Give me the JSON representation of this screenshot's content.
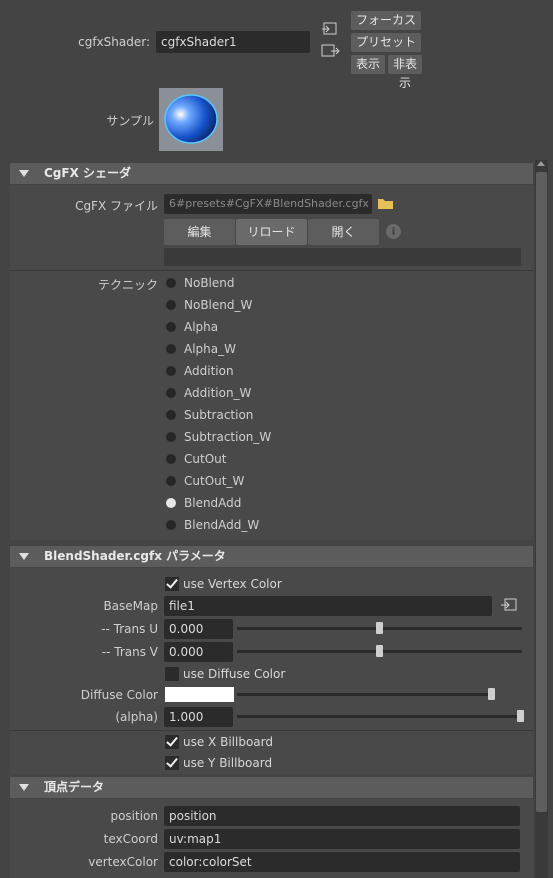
{
  "header": {
    "shader_label": "cgfxShader:",
    "shader_name": "cgfxShader1",
    "focus_button": "フォーカス",
    "preset_button": "プリセット",
    "show_button": "表示",
    "hide_button": "非表示",
    "sample_label": "サンプル"
  },
  "cgfx_section": {
    "title": "CgFX シェーダ",
    "file_label": "CgFX ファイル",
    "file_path": "6#presets#CgFX#BlendShader.cgfx",
    "edit_button": "編集",
    "reload_button": "リロード",
    "open_button": "開く",
    "technique_label": "テクニック",
    "techniques": [
      {
        "label": "NoBlend",
        "selected": false
      },
      {
        "label": "NoBlend_W",
        "selected": false
      },
      {
        "label": "Alpha",
        "selected": false
      },
      {
        "label": "Alpha_W",
        "selected": false
      },
      {
        "label": "Addition",
        "selected": false
      },
      {
        "label": "Addition_W",
        "selected": false
      },
      {
        "label": "Subtraction",
        "selected": false
      },
      {
        "label": "Subtraction_W",
        "selected": false
      },
      {
        "label": "CutOut",
        "selected": false
      },
      {
        "label": "CutOut_W",
        "selected": false
      },
      {
        "label": "BlendAdd",
        "selected": true
      },
      {
        "label": "BlendAdd_W",
        "selected": false
      }
    ]
  },
  "params_section": {
    "title": "BlendShader.cgfx パラメータ",
    "use_vertex_color": {
      "label": "use Vertex Color",
      "checked": true
    },
    "basemap_label": "BaseMap",
    "basemap_value": "file1",
    "trans_u_label": "-- Trans U",
    "trans_u_value": "0.000",
    "trans_u_level": 0.5,
    "trans_v_label": "-- Trans V",
    "trans_v_value": "0.000",
    "trans_v_level": 0.5,
    "use_diffuse_color": {
      "label": "use Diffuse Color",
      "checked": false
    },
    "diffuse_label": "Diffuse Color",
    "diffuse_color": "#ffffff",
    "diffuse_level": 1.0,
    "alpha_label": "(alpha)",
    "alpha_value": "1.000",
    "alpha_level": 1.0,
    "use_x_billboard": {
      "label": "use X Billboard",
      "checked": true
    },
    "use_y_billboard": {
      "label": "use Y Billboard",
      "checked": true
    }
  },
  "vertex_section": {
    "title": "頂点データ",
    "rows": [
      {
        "label": "position",
        "value": "position"
      },
      {
        "label": "texCoord",
        "value": "uv:map1"
      },
      {
        "label": "vertexColor",
        "value": "color:colorSet"
      }
    ]
  },
  "colors": {
    "background": "#444444",
    "section_header": "#5c5c5c",
    "field": "#2b2b2b",
    "swatch_blue": "#2f6fd6"
  }
}
